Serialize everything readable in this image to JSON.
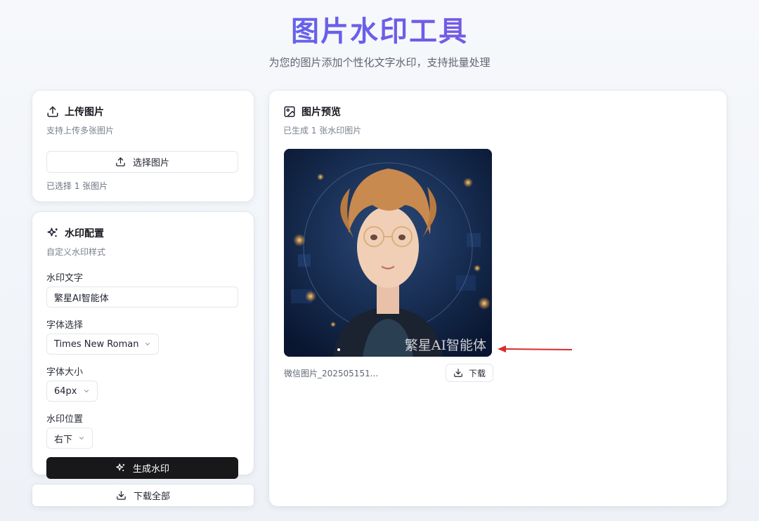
{
  "header": {
    "title": "图片水印工具",
    "subtitle": "为您的图片添加个性化文字水印，支持批量处理"
  },
  "upload": {
    "title": "上传图片",
    "desc": "支持上传多张图片",
    "button": "选择图片",
    "status": "已选择 1 张图片",
    "icon": "upload-icon"
  },
  "config": {
    "title": "水印配置",
    "desc": "自定义水印样式",
    "icon": "sparkles-icon",
    "text_label": "水印文字",
    "text_value": "繁星AI智能体",
    "font_label": "字体选择",
    "font_value": "Times New Roman",
    "size_label": "字体大小",
    "size_value": "64px",
    "position_label": "水印位置",
    "position_value": "右下",
    "generate_button": "生成水印"
  },
  "download_all": "下载全部",
  "preview": {
    "title": "图片预览",
    "desc": "已生成 1 张水印图片",
    "icon": "image-icon",
    "items": [
      {
        "watermark": "繁星AI智能体",
        "file_name": "微信图片_202505151...",
        "download_label": "下载"
      }
    ]
  },
  "colors": {
    "title_gradient_start": "#4f6df0",
    "title_gradient_end": "#8b4fe0",
    "primary_button": "#18181b",
    "annotation_arrow": "#d62d2d"
  }
}
